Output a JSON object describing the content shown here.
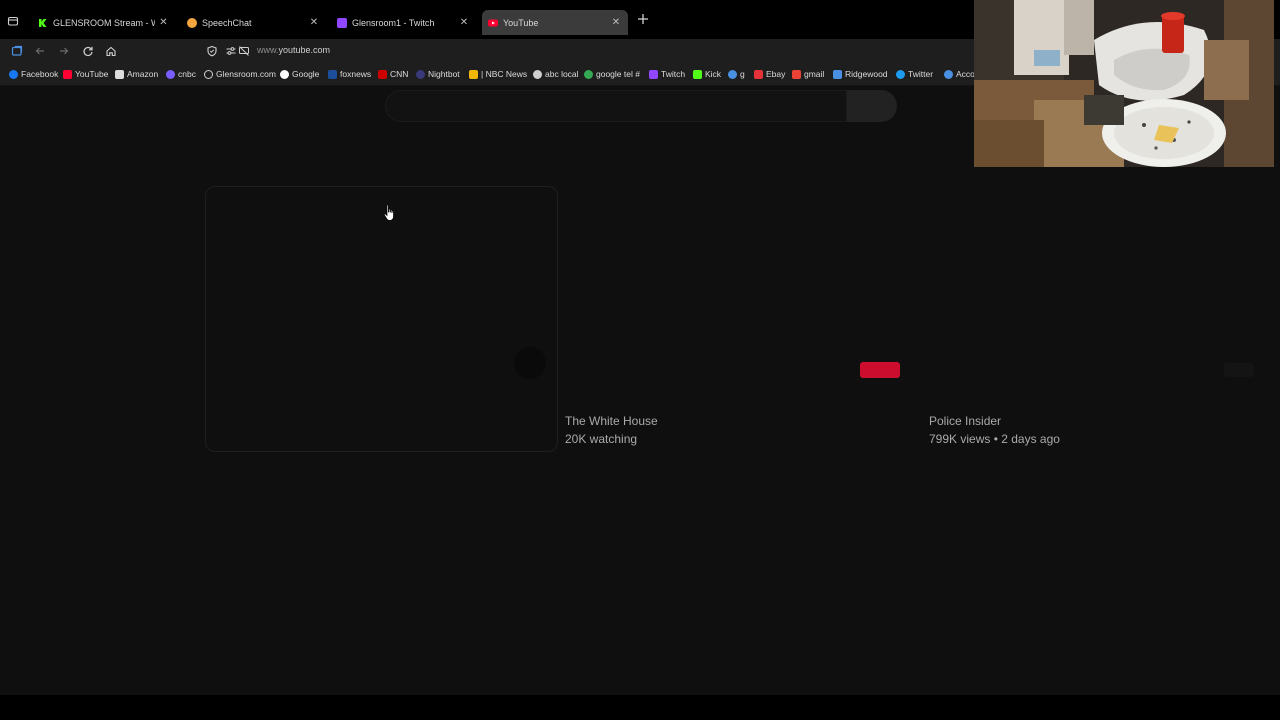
{
  "browser": {
    "tabs": [
      {
        "title": "GLENSROOM Stream - Watch Li",
        "favicon": "kick-icon",
        "favicon_color": "#53fc18",
        "active": false
      },
      {
        "title": "SpeechChat",
        "favicon": "speechchat-icon",
        "favicon_color": "#f2a541",
        "active": false
      },
      {
        "title": "Glensroom1 - Twitch",
        "favicon": "twitch-icon",
        "favicon_color": "#9146ff",
        "active": false
      },
      {
        "title": "YouTube",
        "favicon": "youtube-icon",
        "favicon_color": "#ff0033",
        "active": true
      }
    ],
    "new_tab_icon": "plus-icon",
    "url_prefix": "www.",
    "url_domain": "youtube.com"
  },
  "bookmarks": [
    {
      "label": "Facebook",
      "icon": "facebook-icon",
      "color": "#1877f2"
    },
    {
      "label": "YouTube",
      "icon": "youtube-icon",
      "color": "#ff0033"
    },
    {
      "label": "Amazon",
      "icon": "amazon-icon",
      "color": "#dddddd"
    },
    {
      "label": "cnbc",
      "icon": "cnbc-icon",
      "color": "#7a5cff"
    },
    {
      "label": "Glensroom.com",
      "icon": "globe-icon",
      "color": "#cfcfcf"
    },
    {
      "label": "Google",
      "icon": "google-icon",
      "color": "#ffffff"
    },
    {
      "label": "foxnews",
      "icon": "foxnews-icon",
      "color": "#1c4e9b"
    },
    {
      "label": "CNN",
      "icon": "cnn-icon",
      "color": "#cc0000"
    },
    {
      "label": "Nightbot",
      "icon": "nightbot-icon",
      "color": "#3a3a7a"
    },
    {
      "label": "| NBC News",
      "icon": "nbc-icon",
      "color": "#f2b705"
    },
    {
      "label": "abc local",
      "icon": "abc-icon",
      "color": "#cfcfcf"
    },
    {
      "label": "google tel #",
      "icon": "phone-icon",
      "color": "#34a853"
    },
    {
      "label": "Twitch",
      "icon": "twitch-icon",
      "color": "#9146ff"
    },
    {
      "label": "Kick",
      "icon": "kick-icon",
      "color": "#53fc18"
    },
    {
      "label": "g",
      "icon": "g-icon",
      "color": "#4a90e2"
    },
    {
      "label": "Ebay",
      "icon": "ebay-icon",
      "color": "#e53238"
    },
    {
      "label": "gmail",
      "icon": "gmail-icon",
      "color": "#ea4335"
    },
    {
      "label": "Ridgewood",
      "icon": "ridgewood-icon",
      "color": "#4a90e2"
    },
    {
      "label": "Twitter",
      "icon": "twitter-icon",
      "color": "#1d9bf0"
    },
    {
      "label": "Acco",
      "icon": "account-icon",
      "color": "#4a90e2"
    }
  ],
  "videos": [
    {
      "channel": "The White House",
      "meta": "20K watching",
      "live_badge": false
    },
    {
      "channel": "Police Insider",
      "meta": "799K views • 2 days ago",
      "live_badge": true
    }
  ],
  "colors": {
    "live_badge": "#cc0d2e",
    "page_background": "#0f0f0f"
  }
}
